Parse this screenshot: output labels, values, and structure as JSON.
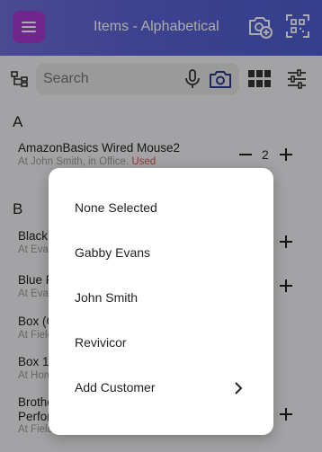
{
  "header": {
    "title": "Items - Alphabetical",
    "menu_icon": "hamburger-menu-icon",
    "icons": [
      "camera-add-icon",
      "scan-icon"
    ],
    "accent": "#a839d6"
  },
  "search": {
    "placeholder": "Search",
    "icons": [
      "tree-view-icon",
      "microphone-icon",
      "camera-icon",
      "grid-view-icon",
      "sliders-icon"
    ]
  },
  "list": {
    "sections": [
      {
        "letter": "A",
        "items": [
          {
            "name": "AmazonBasics Wired Mouse2",
            "location": "At John Smith, in Office.",
            "status": "Used",
            "quantity": "2"
          }
        ]
      },
      {
        "letter": "B",
        "items": [
          {
            "name": "Black",
            "location": "At Evan"
          },
          {
            "name": "Blue F",
            "location": "At Evan"
          },
          {
            "name": "Box (C",
            "location": "At Field"
          },
          {
            "name": "Box 1",
            "location": "At Hom"
          },
          {
            "name": "Brothe",
            "name_line2": "Perfor",
            "location": "At Field"
          }
        ]
      }
    ]
  },
  "popup": {
    "items": [
      {
        "label": "None Selected"
      },
      {
        "label": "Gabby Evans"
      },
      {
        "label": "John Smith"
      },
      {
        "label": "Revivicor"
      },
      {
        "label": "Add Customer"
      }
    ]
  }
}
